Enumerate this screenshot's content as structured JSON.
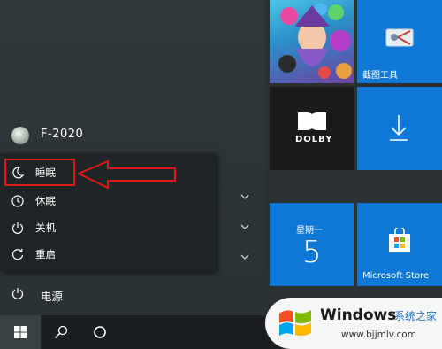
{
  "user": {
    "name": "F-2020"
  },
  "power_menu": {
    "items": [
      {
        "label": "睡眠",
        "icon": "moon-icon"
      },
      {
        "label": "休眠",
        "icon": "clock-icon"
      },
      {
        "label": "关机",
        "icon": "power-icon"
      },
      {
        "label": "重启",
        "icon": "restart-icon"
      }
    ]
  },
  "power_button": {
    "label": "电源",
    "icon": "power-icon"
  },
  "tiles": {
    "snip": {
      "label": "截图工具"
    },
    "dolby": {
      "label": "DOLBY"
    },
    "calendar": {
      "weekday": "星期一",
      "day": "5"
    },
    "store": {
      "label": "Microsoft Store"
    }
  },
  "taskbar": {
    "icons": [
      "windows-start-icon",
      "search-icon",
      "cortana-icon"
    ]
  },
  "watermark": {
    "title": "Windows",
    "subtitle": "系统之家",
    "url": "www.bjjmlv.com"
  },
  "colors": {
    "accent": "#0f78d7",
    "highlight": "#e01a1a",
    "panel": "#2d3436",
    "flyout": "#1f2426"
  }
}
